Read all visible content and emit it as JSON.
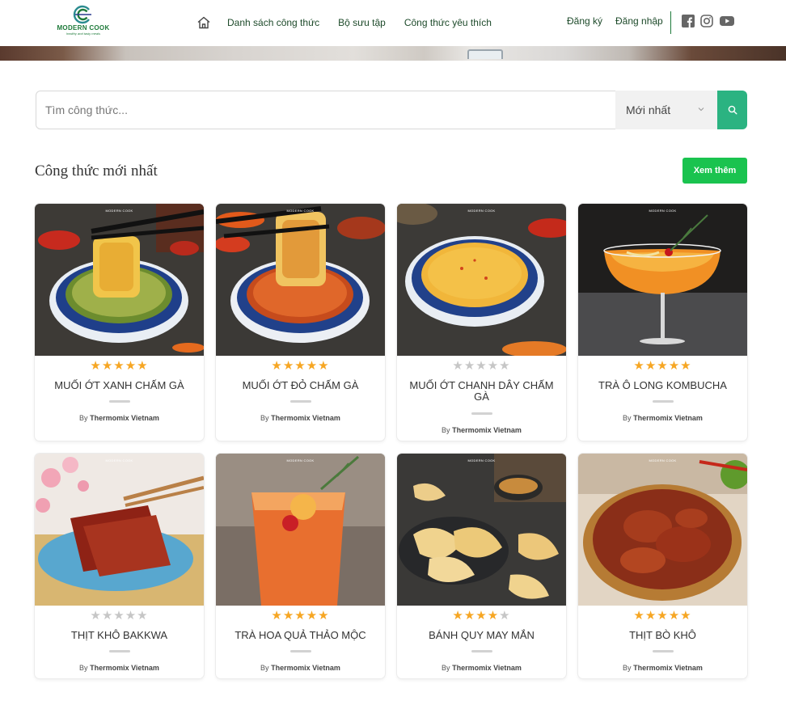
{
  "brand": {
    "name": "MODERN COOK",
    "tagline": "healthy and tasty meals",
    "colors": {
      "primary": "#1e7a3a",
      "accent": "#2bb381",
      "button": "#1ac34f",
      "star": "#f6a623"
    }
  },
  "nav": {
    "home_icon": "home-icon",
    "items": [
      {
        "label": "Danh sách công thức"
      },
      {
        "label": "Bộ sưu tập"
      },
      {
        "label": "Công thức yêu thích"
      }
    ],
    "register": "Đăng ký",
    "login": "Đăng nhập",
    "social": [
      "facebook-icon",
      "instagram-icon",
      "youtube-icon"
    ]
  },
  "search": {
    "placeholder": "Tìm công thức...",
    "value": "",
    "sort_selected": "Mới nhất",
    "button_icon": "search-icon"
  },
  "section": {
    "title": "Công thức mới nhất",
    "more_label": "Xem thêm"
  },
  "recipes": [
    {
      "title": "MUỐI ỚT XANH CHẤM GÀ",
      "rating": 5,
      "author_prefix": "By",
      "author": "Thermomix Vietnam"
    },
    {
      "title": "MUỐI ỚT ĐỎ CHẤM GÀ",
      "rating": 5,
      "author_prefix": "By",
      "author": "Thermomix Vietnam"
    },
    {
      "title": "MUỐI ỚT CHANH DÂY CHẤM GÀ",
      "rating": 0,
      "author_prefix": "By",
      "author": "Thermomix Vietnam"
    },
    {
      "title": "TRÀ Ô LONG KOMBUCHA",
      "rating": 5,
      "author_prefix": "By",
      "author": "Thermomix Vietnam"
    },
    {
      "title": "THỊT KHÔ BAKKWA",
      "rating": 0,
      "author_prefix": "By",
      "author": "Thermomix Vietnam"
    },
    {
      "title": "TRÀ HOA QUẢ THẢO MỘC",
      "rating": 5,
      "author_prefix": "By",
      "author": "Thermomix Vietnam"
    },
    {
      "title": "BÁNH QUY MAY MẮN",
      "rating": 4,
      "author_prefix": "By",
      "author": "Thermomix Vietnam"
    },
    {
      "title": "THỊT BÒ KHÔ",
      "rating": 5,
      "author_prefix": "By",
      "author": "Thermomix Vietnam"
    }
  ]
}
